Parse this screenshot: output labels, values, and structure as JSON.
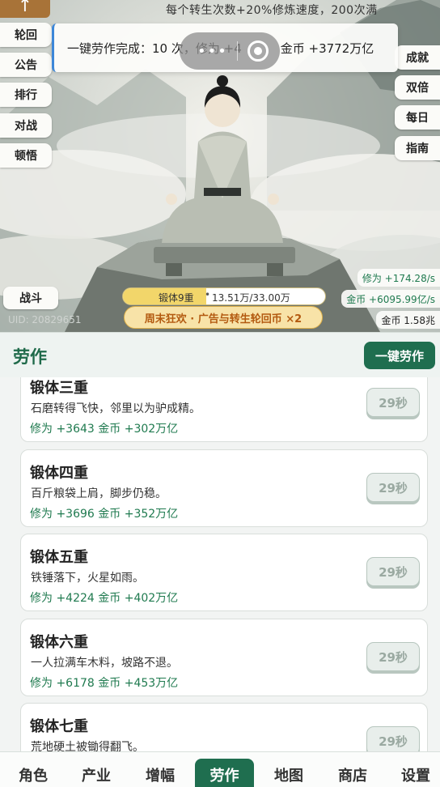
{
  "header": {
    "corner_glyph": "↑",
    "banner": "每个转生次数+20%修炼速度，200次满"
  },
  "left_menu": [
    {
      "label": "轮回"
    },
    {
      "label": "公告"
    },
    {
      "label": "排行"
    },
    {
      "label": "对战"
    },
    {
      "label": "顿悟"
    }
  ],
  "right_menu": [
    {
      "label": "成就"
    },
    {
      "label": "双倍"
    },
    {
      "label": "每日"
    },
    {
      "label": "指南"
    }
  ],
  "notice": {
    "text": "一键劳作完成：10 次，修为 +4",
    "gold": "金币 +3772万亿",
    "capsule_dots": "•••"
  },
  "battle": {
    "label": "战斗"
  },
  "uid": "UID: 20829651",
  "realm": {
    "name": "锻体9重",
    "separator": "•",
    "progress_text": "13.51万/33.00万",
    "progress": 0.41
  },
  "promo": "周末狂欢 · 广告与转生轮回币 ×2",
  "rates": {
    "cultivation": "修为 +174.28/s",
    "gold_rate": "金币 +6095.99亿/s",
    "gold_total": "金币 1.58兆"
  },
  "work": {
    "title": "劳作",
    "one_click": "一键劳作",
    "tasks": [
      {
        "name": "锻体三重",
        "desc": "石磨转得飞快，邻里以为驴成精。",
        "reward": "修为 +3643  金币 +302万亿",
        "timer": "29秒"
      },
      {
        "name": "锻体四重",
        "desc": "百斤粮袋上肩，脚步仍稳。",
        "reward": "修为 +3696  金币 +352万亿",
        "timer": "29秒"
      },
      {
        "name": "锻体五重",
        "desc": "铁锤落下，火星如雨。",
        "reward": "修为 +4224  金币 +402万亿",
        "timer": "29秒"
      },
      {
        "name": "锻体六重",
        "desc": "一人拉满车木料，坡路不退。",
        "reward": "修为 +6178  金币 +453万亿",
        "timer": "29秒"
      },
      {
        "name": "锻体七重",
        "desc": "荒地硬土被锄得翻飞。",
        "reward": "",
        "timer": "29秒"
      }
    ]
  },
  "nav": [
    {
      "label": "角色"
    },
    {
      "label": "产业"
    },
    {
      "label": "增幅"
    },
    {
      "label": "劳作",
      "active": true
    },
    {
      "label": "地图"
    },
    {
      "label": "商店"
    },
    {
      "label": "设置"
    }
  ]
}
